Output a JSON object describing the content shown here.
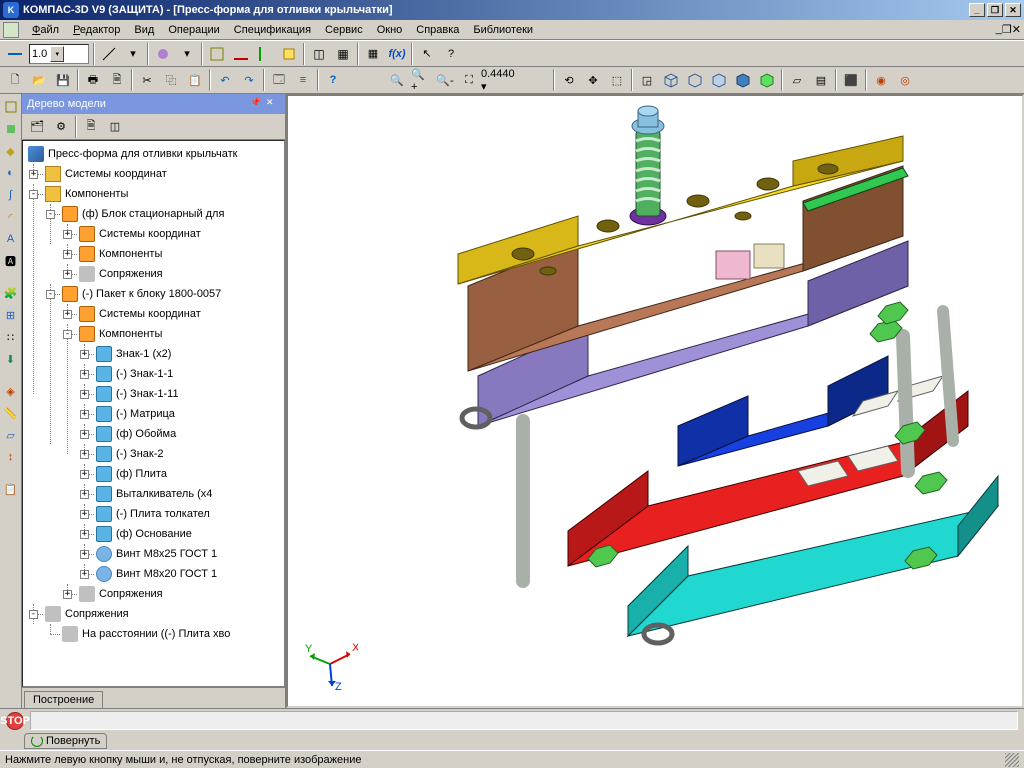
{
  "titlebar": {
    "app": "КОМПАС-3D V9 (ЗАЩИТА)",
    "doc": "[Пресс-форма для отливки крыльчатки]"
  },
  "menubar": {
    "file": "Файл",
    "edit": "Редактор",
    "view": "Вид",
    "ops": "Операции",
    "spec": "Спецификация",
    "service": "Сервис",
    "window": "Окно",
    "help": "Справка",
    "libs": "Библиотеки"
  },
  "toolbar": {
    "scale": "1.0",
    "zoom": "0.4440"
  },
  "treepanel": {
    "title": "Дерево модели",
    "tab": "Построение",
    "root": "Пресс-форма для отливки крыльчатк",
    "nodes": {
      "coordsys": "Системы координат",
      "components": "Компоненты",
      "block": "(ф) Блок стационарный для ",
      "coordsys2": "Системы координат",
      "components2": "Компоненты",
      "mates2": "Сопряжения",
      "packet": "(-) Пакет к блоку 1800-0057",
      "coordsys3": "Системы координат",
      "components3": "Компоненты",
      "znak1": "Знак-1 (x2)",
      "znak11": "(-) Знак-1-1",
      "znak111": "(-) Знак-1-11",
      "matrix": "(-) Матрица",
      "oboima": "(ф) Обойма",
      "znak2": "(-) Знак-2",
      "plita": "(ф) Плита",
      "ejector": "Выталкиватель (x4",
      "pushplate": "(-) Плита толкател",
      "base": "(ф) Основание",
      "screw1": "Винт М8x25 ГОСТ 1",
      "screw2": "Винт М8x20 ГОСТ 1",
      "mates3": "Сопряжения",
      "mates": "Сопряжения",
      "dist": "На расстоянии ((-) Плита хво"
    }
  },
  "bottompane": {
    "tab": "Повернуть",
    "stop": "STOP"
  },
  "statusbar": {
    "text": "Нажмите левую кнопку мыши и, не отпуская, поверните изображение"
  },
  "axes": {
    "x": "X",
    "y": "Y",
    "z": "Z"
  }
}
